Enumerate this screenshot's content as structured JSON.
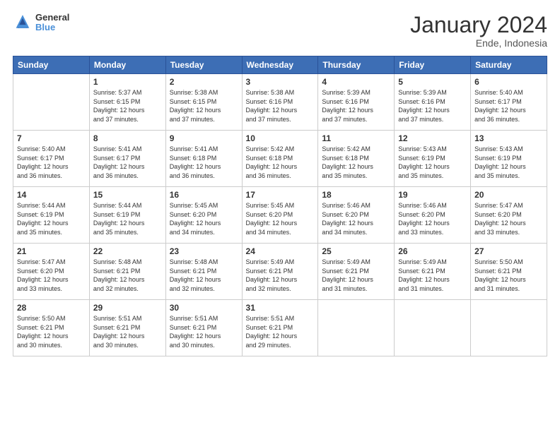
{
  "header": {
    "title": "January 2024",
    "subtitle": "Ende, Indonesia",
    "logo_line1": "General",
    "logo_line2": "Blue"
  },
  "weekdays": [
    "Sunday",
    "Monday",
    "Tuesday",
    "Wednesday",
    "Thursday",
    "Friday",
    "Saturday"
  ],
  "weeks": [
    [
      {
        "day": "",
        "sunrise": "",
        "sunset": "",
        "daylight": ""
      },
      {
        "day": "1",
        "sunrise": "5:37 AM",
        "sunset": "6:15 PM",
        "daylight": "12 hours and 37 minutes."
      },
      {
        "day": "2",
        "sunrise": "5:38 AM",
        "sunset": "6:15 PM",
        "daylight": "12 hours and 37 minutes."
      },
      {
        "day": "3",
        "sunrise": "5:38 AM",
        "sunset": "6:16 PM",
        "daylight": "12 hours and 37 minutes."
      },
      {
        "day": "4",
        "sunrise": "5:39 AM",
        "sunset": "6:16 PM",
        "daylight": "12 hours and 37 minutes."
      },
      {
        "day": "5",
        "sunrise": "5:39 AM",
        "sunset": "6:16 PM",
        "daylight": "12 hours and 37 minutes."
      },
      {
        "day": "6",
        "sunrise": "5:40 AM",
        "sunset": "6:17 PM",
        "daylight": "12 hours and 36 minutes."
      }
    ],
    [
      {
        "day": "7",
        "sunrise": "5:40 AM",
        "sunset": "6:17 PM",
        "daylight": "12 hours and 36 minutes."
      },
      {
        "day": "8",
        "sunrise": "5:41 AM",
        "sunset": "6:17 PM",
        "daylight": "12 hours and 36 minutes."
      },
      {
        "day": "9",
        "sunrise": "5:41 AM",
        "sunset": "6:18 PM",
        "daylight": "12 hours and 36 minutes."
      },
      {
        "day": "10",
        "sunrise": "5:42 AM",
        "sunset": "6:18 PM",
        "daylight": "12 hours and 36 minutes."
      },
      {
        "day": "11",
        "sunrise": "5:42 AM",
        "sunset": "6:18 PM",
        "daylight": "12 hours and 35 minutes."
      },
      {
        "day": "12",
        "sunrise": "5:43 AM",
        "sunset": "6:19 PM",
        "daylight": "12 hours and 35 minutes."
      },
      {
        "day": "13",
        "sunrise": "5:43 AM",
        "sunset": "6:19 PM",
        "daylight": "12 hours and 35 minutes."
      }
    ],
    [
      {
        "day": "14",
        "sunrise": "5:44 AM",
        "sunset": "6:19 PM",
        "daylight": "12 hours and 35 minutes."
      },
      {
        "day": "15",
        "sunrise": "5:44 AM",
        "sunset": "6:19 PM",
        "daylight": "12 hours and 35 minutes."
      },
      {
        "day": "16",
        "sunrise": "5:45 AM",
        "sunset": "6:20 PM",
        "daylight": "12 hours and 34 minutes."
      },
      {
        "day": "17",
        "sunrise": "5:45 AM",
        "sunset": "6:20 PM",
        "daylight": "12 hours and 34 minutes."
      },
      {
        "day": "18",
        "sunrise": "5:46 AM",
        "sunset": "6:20 PM",
        "daylight": "12 hours and 34 minutes."
      },
      {
        "day": "19",
        "sunrise": "5:46 AM",
        "sunset": "6:20 PM",
        "daylight": "12 hours and 33 minutes."
      },
      {
        "day": "20",
        "sunrise": "5:47 AM",
        "sunset": "6:20 PM",
        "daylight": "12 hours and 33 minutes."
      }
    ],
    [
      {
        "day": "21",
        "sunrise": "5:47 AM",
        "sunset": "6:20 PM",
        "daylight": "12 hours and 33 minutes."
      },
      {
        "day": "22",
        "sunrise": "5:48 AM",
        "sunset": "6:21 PM",
        "daylight": "12 hours and 32 minutes."
      },
      {
        "day": "23",
        "sunrise": "5:48 AM",
        "sunset": "6:21 PM",
        "daylight": "12 hours and 32 minutes."
      },
      {
        "day": "24",
        "sunrise": "5:49 AM",
        "sunset": "6:21 PM",
        "daylight": "12 hours and 32 minutes."
      },
      {
        "day": "25",
        "sunrise": "5:49 AM",
        "sunset": "6:21 PM",
        "daylight": "12 hours and 31 minutes."
      },
      {
        "day": "26",
        "sunrise": "5:49 AM",
        "sunset": "6:21 PM",
        "daylight": "12 hours and 31 minutes."
      },
      {
        "day": "27",
        "sunrise": "5:50 AM",
        "sunset": "6:21 PM",
        "daylight": "12 hours and 31 minutes."
      }
    ],
    [
      {
        "day": "28",
        "sunrise": "5:50 AM",
        "sunset": "6:21 PM",
        "daylight": "12 hours and 30 minutes."
      },
      {
        "day": "29",
        "sunrise": "5:51 AM",
        "sunset": "6:21 PM",
        "daylight": "12 hours and 30 minutes."
      },
      {
        "day": "30",
        "sunrise": "5:51 AM",
        "sunset": "6:21 PM",
        "daylight": "12 hours and 30 minutes."
      },
      {
        "day": "31",
        "sunrise": "5:51 AM",
        "sunset": "6:21 PM",
        "daylight": "12 hours and 29 minutes."
      },
      {
        "day": "",
        "sunrise": "",
        "sunset": "",
        "daylight": ""
      },
      {
        "day": "",
        "sunrise": "",
        "sunset": "",
        "daylight": ""
      },
      {
        "day": "",
        "sunrise": "",
        "sunset": "",
        "daylight": ""
      }
    ]
  ],
  "labels": {
    "sunrise_prefix": "Sunrise: ",
    "sunset_prefix": "Sunset: ",
    "daylight_prefix": "Daylight: "
  }
}
